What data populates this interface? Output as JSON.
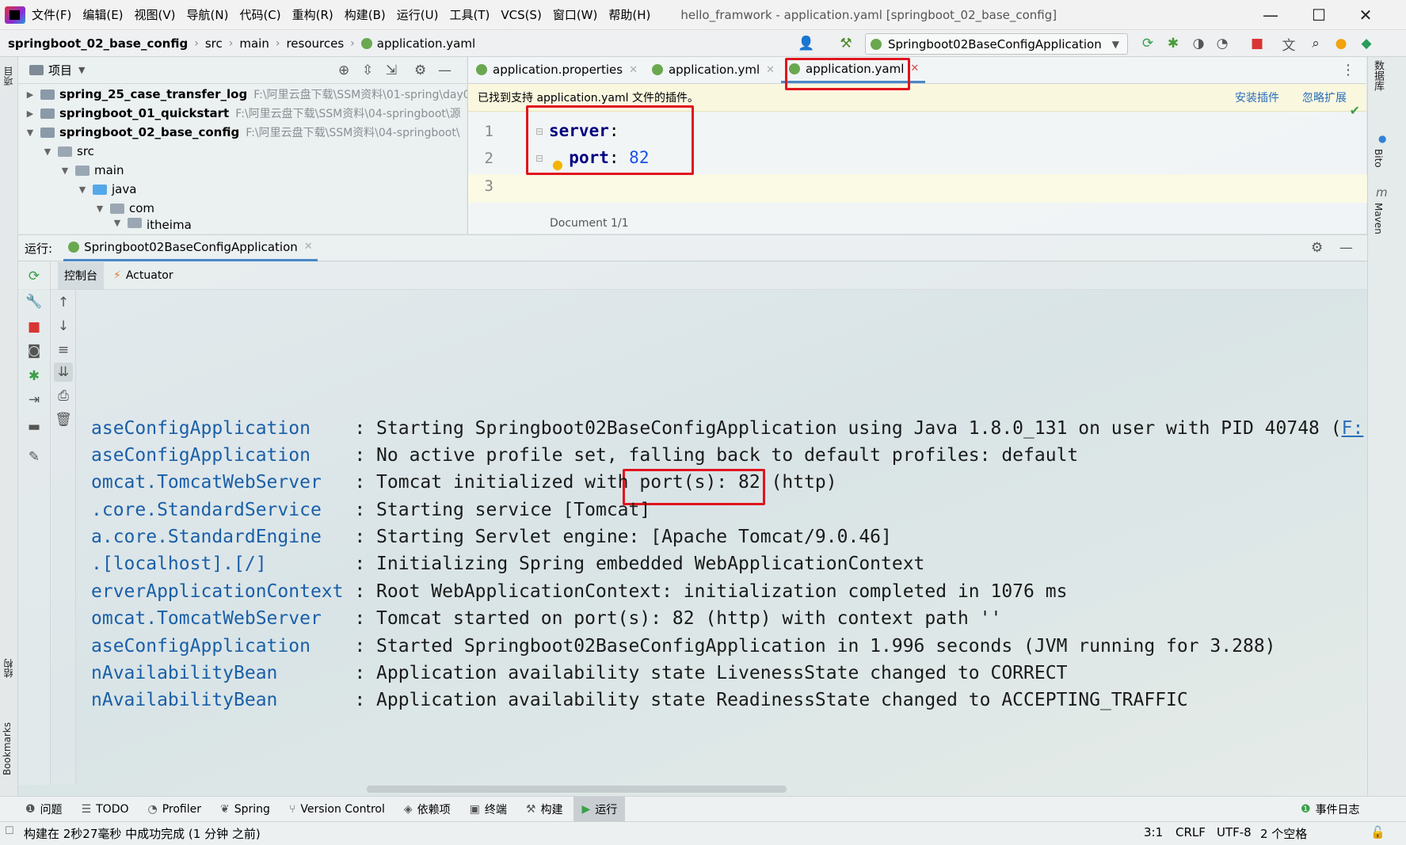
{
  "window": {
    "title": "hello_framwork - application.yaml [springboot_02_base_config]",
    "menu": [
      "文件(F)",
      "编辑(E)",
      "视图(V)",
      "导航(N)",
      "代码(C)",
      "重构(R)",
      "构建(B)",
      "运行(U)",
      "工具(T)",
      "VCS(S)",
      "窗口(W)",
      "帮助(H)"
    ],
    "controls": {
      "minimize": "—",
      "maximize": "☐",
      "close": "✕"
    }
  },
  "breadcrumb": [
    "springboot_02_base_config",
    "src",
    "main",
    "resources",
    "application.yaml"
  ],
  "run_config": "Springboot02BaseConfigApplication",
  "project_panel": {
    "title": "项目",
    "tree": [
      {
        "name": "spring_25_case_transfer_log",
        "path": "F:\\阿里云盘下载\\SSM资料\\01-spring\\day0",
        "bold": true
      },
      {
        "name": "springboot_01_quickstart",
        "path": "F:\\阿里云盘下载\\SSM资料\\04-springboot\\源",
        "bold": true
      },
      {
        "name": "springboot_02_base_config",
        "path": "F:\\阿里云盘下载\\SSM资料\\04-springboot\\",
        "bold": true
      },
      {
        "name": "src",
        "path": "",
        "bold": false
      },
      {
        "name": "main",
        "path": "",
        "bold": false
      },
      {
        "name": "java",
        "path": "",
        "bold": false
      },
      {
        "name": "com",
        "path": "",
        "bold": false
      },
      {
        "name": "itheima",
        "path": "",
        "bold": false
      }
    ]
  },
  "editor": {
    "tabs": [
      {
        "label": "application.properties",
        "active": false
      },
      {
        "label": "application.yml",
        "active": false
      },
      {
        "label": "application.yaml",
        "active": true
      }
    ],
    "banner": {
      "message": "已找到支持 application.yaml 文件的插件。",
      "install": "安装插件",
      "ignore": "忽略扩展"
    },
    "line_numbers": [
      "1",
      "2",
      "3"
    ],
    "code": {
      "key1": "server",
      "colon1": ":",
      "key2": "port",
      "colon2": ": ",
      "value2": "82"
    },
    "doc_info": "Document 1/1"
  },
  "right_strip": [
    "数据库",
    "Bito",
    "Maven"
  ],
  "left_strip": [
    "项目",
    "结构",
    "Bookmarks"
  ],
  "run_panel": {
    "label": "运行:",
    "tab": "Springboot02BaseConfigApplication",
    "subtabs": [
      "控制台",
      "Actuator"
    ],
    "console": [
      {
        "logger": "aseConfigApplication    ",
        "msg": "Starting Springboot02BaseConfigApplication using Java 1.8.0_131 on user with PID 40748 (",
        "link": "F:"
      },
      {
        "logger": "aseConfigApplication    ",
        "msg": "No active profile set, falling back to default profiles: default",
        "link": ""
      },
      {
        "logger": "omcat.TomcatWebServer   ",
        "msg": "Tomcat initialized with port(s): 82 (http)",
        "link": ""
      },
      {
        "logger": ".core.StandardService   ",
        "msg": "Starting service [Tomcat]",
        "link": ""
      },
      {
        "logger": "a.core.StandardEngine   ",
        "msg": "Starting Servlet engine: [Apache Tomcat/9.0.46]",
        "link": ""
      },
      {
        "logger": ".[localhost].[/]        ",
        "msg": "Initializing Spring embedded WebApplicationContext",
        "link": ""
      },
      {
        "logger": "erverApplicationContext ",
        "msg": "Root WebApplicationContext: initialization completed in 1076 ms",
        "link": ""
      },
      {
        "logger": "omcat.TomcatWebServer   ",
        "msg": "Tomcat started on port(s): 82 (http) with context path ''",
        "link": ""
      },
      {
        "logger": "aseConfigApplication    ",
        "msg": "Started Springboot02BaseConfigApplication in 1.996 seconds (JVM running for 3.288)",
        "link": ""
      },
      {
        "logger": "nAvailabilityBean       ",
        "msg": "Application availability state LivenessState changed to CORRECT",
        "link": ""
      },
      {
        "logger": "nAvailabilityBean       ",
        "msg": "Application availability state ReadinessState changed to ACCEPTING_TRAFFIC",
        "link": ""
      }
    ]
  },
  "bottom_tools": [
    {
      "label": "问题",
      "active": false
    },
    {
      "label": "TODO",
      "active": false
    },
    {
      "label": "Profiler",
      "active": false
    },
    {
      "label": "Spring",
      "active": false
    },
    {
      "label": "Version Control",
      "active": false
    },
    {
      "label": "依赖项",
      "active": false
    },
    {
      "label": "终端",
      "active": false
    },
    {
      "label": "构建",
      "active": false
    },
    {
      "label": "运行",
      "active": true
    }
  ],
  "event_log": "事件日志",
  "status": {
    "message": "构建在 2秒27毫秒 中成功完成 (1 分钟 之前)",
    "position": "3:1",
    "line_sep": "CRLF",
    "encoding": "UTF-8",
    "indent": "2 个空格"
  },
  "colors": {
    "highlight": "#e0141e",
    "accent": "#4a88c7",
    "keyword": "#000080",
    "number": "#1750eb"
  }
}
